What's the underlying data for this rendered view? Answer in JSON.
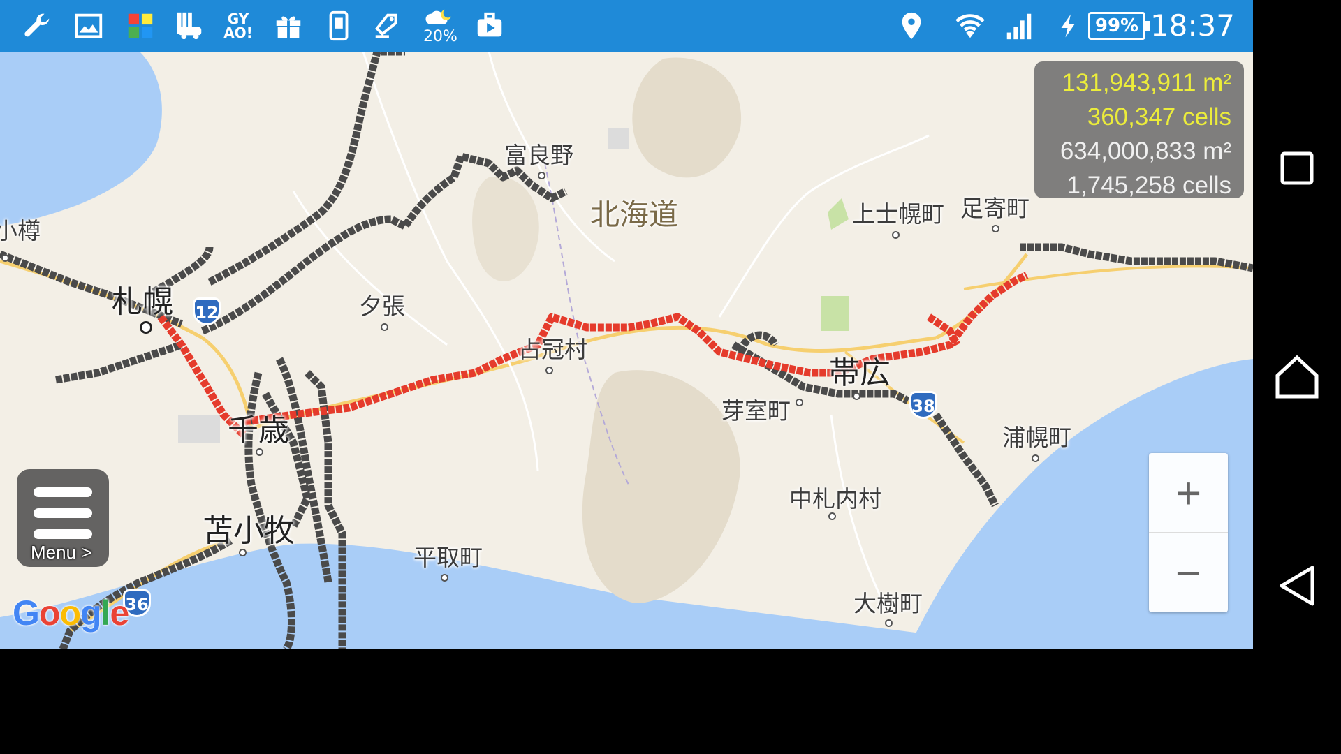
{
  "status_bar": {
    "time": "18:37",
    "battery_percent": "99%",
    "weather_percent": "20%",
    "left_icons": [
      "wrench-icon",
      "image-icon",
      "app-grid-icon",
      "parking-icon",
      "gyao-icon",
      "gift-icon",
      "phone-copy-icon",
      "shopping-tag-icon",
      "weather-moon-icon",
      "video-briefcase-icon"
    ],
    "gyao_label": "GY\nAO!",
    "right_icons": [
      "location-pin-icon",
      "wifi-icon",
      "signal-icon",
      "charging-icon"
    ]
  },
  "stats": {
    "visited_area": "131,943,911 m²",
    "visited_cells": "360,347 cells",
    "total_area": "634,000,833 m²",
    "total_cells": "1,745,258 cells",
    "highlight_color": "#eced3a"
  },
  "map": {
    "labels": {
      "otaru": "小樽",
      "sapporo": "札幌",
      "furano": "富良野",
      "hokkaido": "北海道",
      "yubari": "夕張",
      "kamishihoro": "上士幌町",
      "ashoro": "足寄町",
      "shimukappu": "占冠村",
      "obihiro": "帯広",
      "memuro": "芽室町",
      "chitose": "千歳",
      "urahoro": "浦幌町",
      "nakasatsunai": "中札内村",
      "tomakomai": "苫小牧",
      "biratori": "平取町",
      "taiki": "大樹町"
    },
    "route_shields": {
      "r12": "12",
      "r38": "38",
      "r36": "36"
    },
    "track_color": "#4a4a4a",
    "active_track_color": "#e53b2c"
  },
  "menu": {
    "label": "Menu >"
  },
  "zoom": {
    "plus": "+",
    "minus": "−"
  },
  "attribution": {
    "letters": [
      "G",
      "o",
      "o",
      "g",
      "l",
      "e"
    ],
    "colors": [
      "#4285f4",
      "#ea4335",
      "#fbbc05",
      "#4285f4",
      "#34a853",
      "#ea4335"
    ]
  },
  "nav_bar": {
    "buttons": [
      "recent-apps-icon",
      "home-icon",
      "back-icon"
    ]
  }
}
